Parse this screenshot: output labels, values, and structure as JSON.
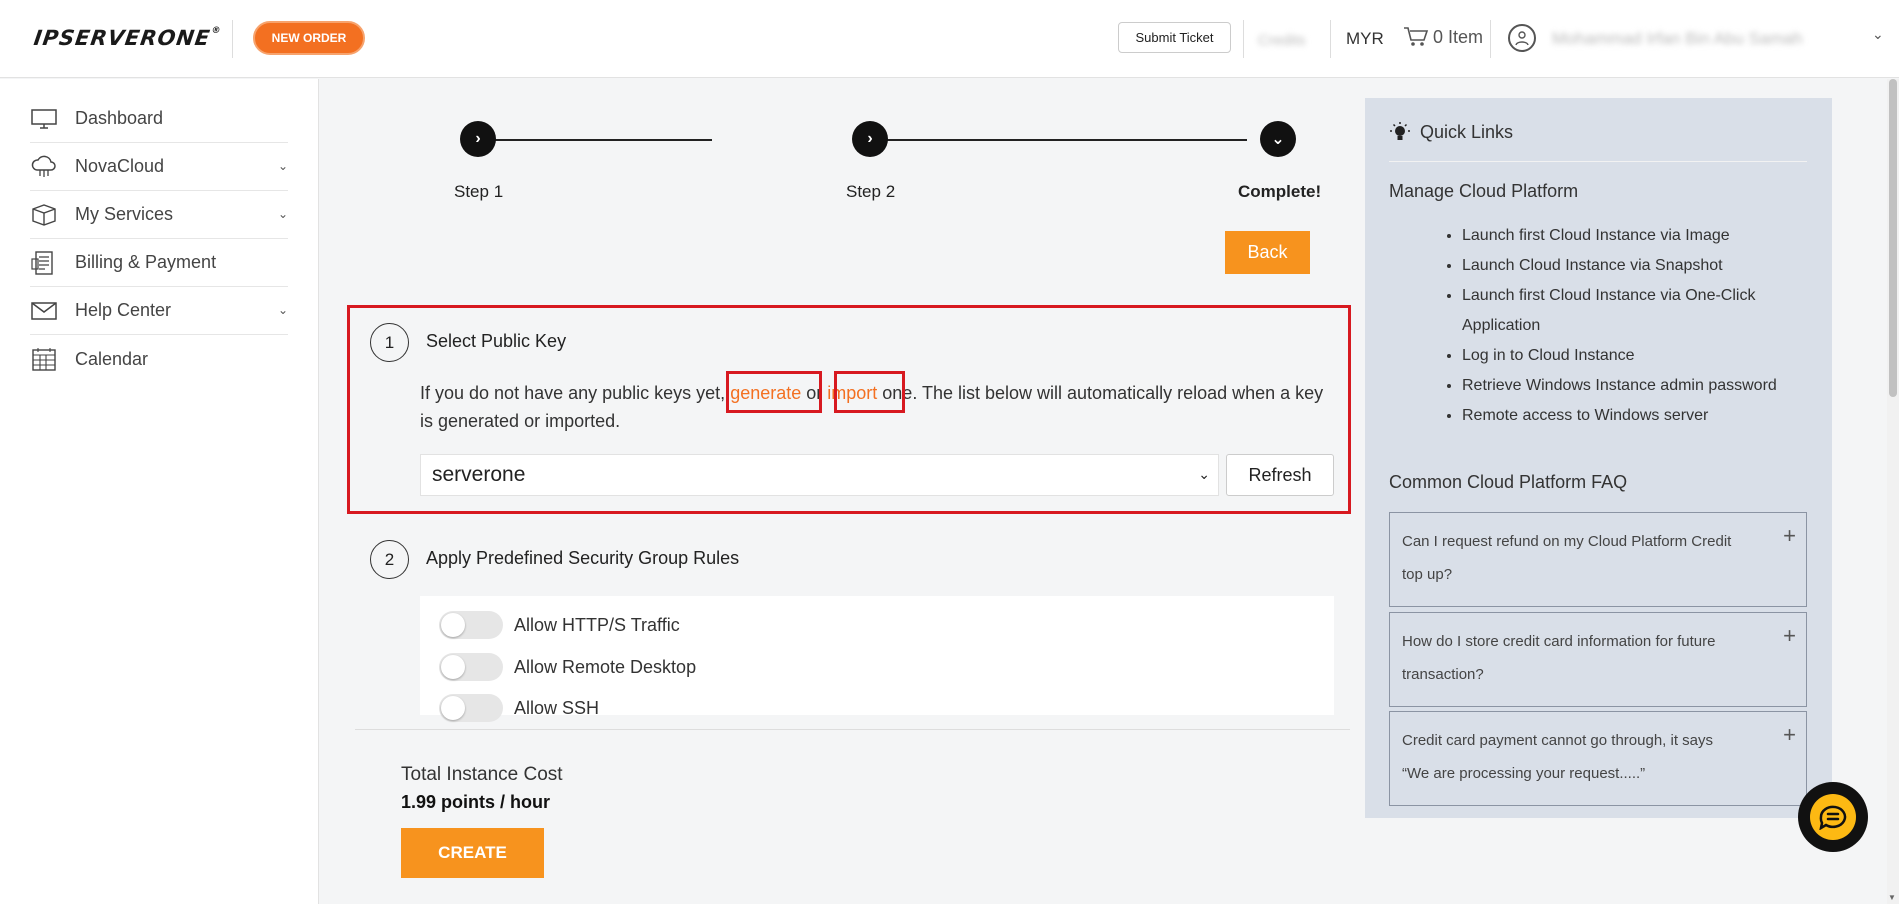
{
  "header": {
    "logo": "IPSERVERONE",
    "logo_mark": "®",
    "new_order": "NEW ORDER",
    "submit_ticket": "Submit Ticket",
    "credits_blurred": "Credits",
    "currency": "MYR",
    "cart_label": "0 Item",
    "user_blurred": "Mohammad Irfan Bin Abu Samah"
  },
  "sidebar": {
    "items": [
      {
        "label": "Dashboard",
        "icon": "monitor-icon",
        "has_chevron": false
      },
      {
        "label": "NovaCloud",
        "icon": "cloud-icon",
        "has_chevron": true
      },
      {
        "label": "My Services",
        "icon": "box-icon",
        "has_chevron": true
      },
      {
        "label": "Billing & Payment",
        "icon": "invoice-icon",
        "has_chevron": false
      },
      {
        "label": "Help Center",
        "icon": "mail-icon",
        "has_chevron": true
      },
      {
        "label": "Calendar",
        "icon": "calendar-icon",
        "has_chevron": false
      }
    ]
  },
  "steps": {
    "step1": "Step 1",
    "step2": "Step 2",
    "complete": "Complete!"
  },
  "back_button": "Back",
  "public_key": {
    "number": "1",
    "title": "Select Public Key",
    "text_before": "If you do not have any public keys yet, ",
    "generate": "generate",
    "text_or": " or ",
    "import": "import",
    "text_after": " one. The list below will automatically reload when a key is generated or imported.",
    "selected": "serverone",
    "refresh": "Refresh"
  },
  "security": {
    "number": "2",
    "title": "Apply Predefined Security Group Rules",
    "rules": [
      "Allow HTTP/S Traffic",
      "Allow Remote Desktop",
      "Allow SSH"
    ]
  },
  "cost": {
    "label": "Total Instance Cost",
    "value": "1.99 points / hour",
    "create": "CREATE"
  },
  "quick_links": {
    "title": "Quick Links",
    "manage_title": "Manage Cloud Platform",
    "links": [
      "Launch first Cloud Instance via Image",
      "Launch Cloud Instance via Snapshot",
      "Launch first Cloud Instance via One-Click Application",
      "Log in to Cloud Instance",
      "Retrieve Windows Instance admin password",
      "Remote access to Windows server"
    ],
    "faq_title": "Common Cloud Platform FAQ",
    "faqs": [
      "Can I request refund on my Cloud Platform Credit top up?",
      "How do I store credit card information for future transaction?",
      "Credit card payment cannot go through, it says “We are processing your request.....”"
    ]
  },
  "colors": {
    "accent": "#f7931e",
    "brand_orange": "#f37021",
    "highlight_red": "#d71920",
    "quicklinks_bg": "#d9dfe8"
  }
}
